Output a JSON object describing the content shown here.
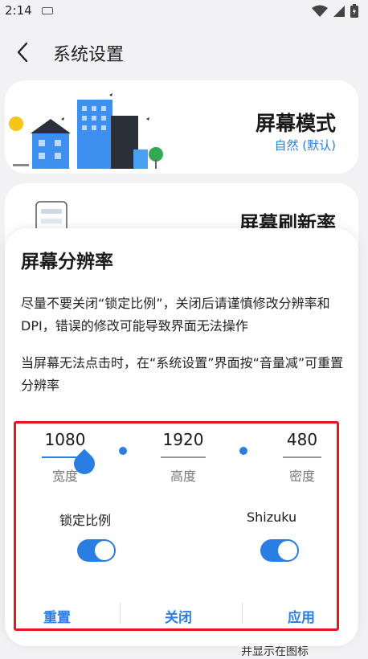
{
  "status": {
    "time": "2:14"
  },
  "header": {
    "title": "系统设置"
  },
  "mode_card": {
    "title": "屏幕模式",
    "value": "自然 (默认)"
  },
  "refresh_card": {
    "title": "屏幕刷新率"
  },
  "dialog": {
    "title": "屏幕分辨率",
    "paragraph1": "尽量不要关闭“锁定比例”，关闭后请谨慎修改分辨率和DPI，错误的修改可能导致界面无法操作",
    "paragraph2": "当屏幕无法点击时，在“系统设置”界面按“音量减”可重置分辨率",
    "width": {
      "value": "1080",
      "label": "宽度"
    },
    "height": {
      "value": "1920",
      "label": "高度"
    },
    "density": {
      "value": "480",
      "label": "密度"
    },
    "lock_ratio": {
      "label": "锁定比例",
      "on": true
    },
    "shizuku": {
      "label": "Shizuku",
      "on": true
    },
    "actions": {
      "reset": "重置",
      "close": "关闭",
      "apply": "应用"
    }
  },
  "bottom_peek": "并显示在图标",
  "colors": {
    "accent": "#2a7de1",
    "highlight": "#e5161c"
  }
}
